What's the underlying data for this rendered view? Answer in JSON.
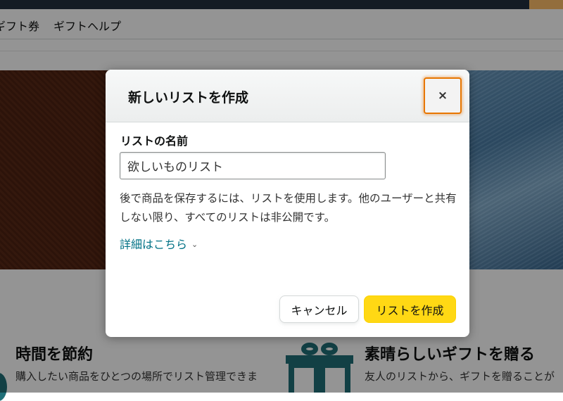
{
  "background": {
    "subnav": [
      "ギフト券",
      "ギフトヘルプ"
    ],
    "features": [
      {
        "title": "時間を節約",
        "description": "購入したい商品をひとつの場所でリスト管理できま"
      },
      {
        "title": "素晴らしいギフトを贈る",
        "description": "友人のリストから、ギフトを贈ることが"
      }
    ],
    "feature_icon": "gift-icon"
  },
  "modal": {
    "title": "新しいリストを作成",
    "close_icon": "close-icon",
    "close_label": "×",
    "field_label": "リストの名前",
    "name_value": "欲しいものリスト",
    "help_text": "後で商品を保存するには、リストを使用します。他のユーザーと共有しない限り、すべてのリストは非公開です。",
    "details_link": "詳細はこちら",
    "details_icon": "chevron-down-icon",
    "cancel_label": "キャンセル",
    "create_label": "リストを作成"
  },
  "colors": {
    "primary_button": "#ffd814",
    "link": "#007185",
    "focus_ring": "#e77600",
    "header_bar": "#232f3e"
  }
}
